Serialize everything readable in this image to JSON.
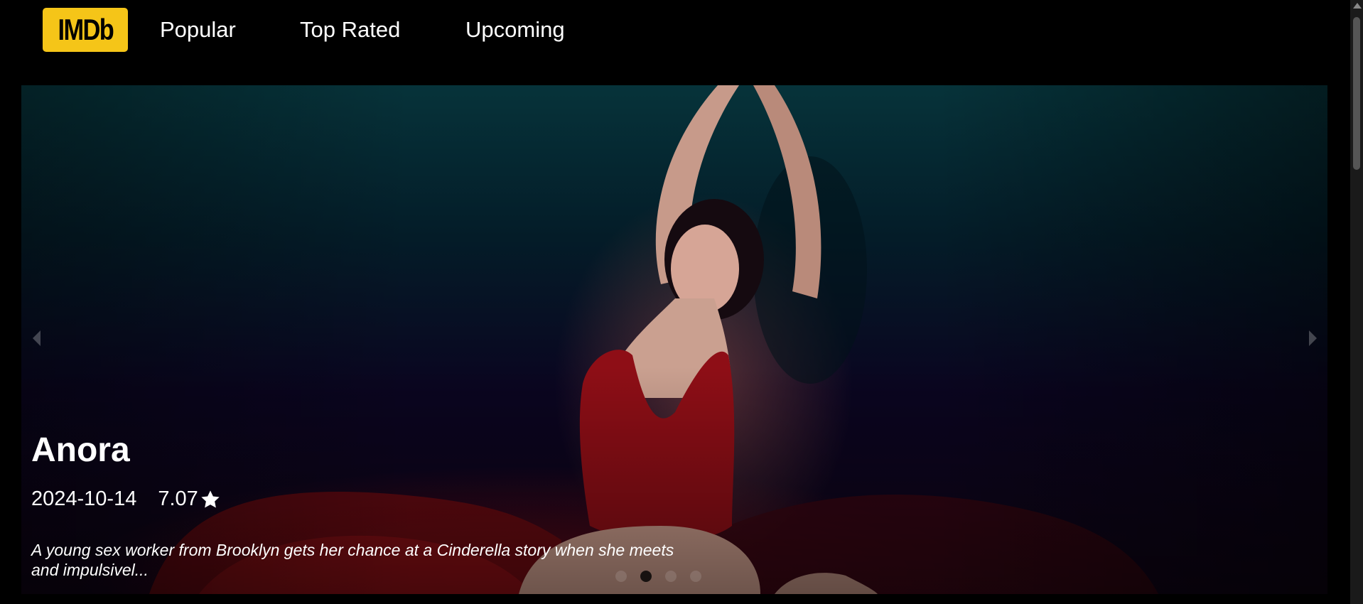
{
  "header": {
    "logo_text": "IMDb",
    "nav": {
      "popular": "Popular",
      "top_rated": "Top Rated",
      "upcoming": "Upcoming"
    }
  },
  "hero": {
    "title": "Anora",
    "release_date": "2024-10-14",
    "rating": "7.07",
    "overview": "A young sex worker from Brooklyn gets her chance at a Cinderella story when she meets and impulsivel...",
    "active_slide": 2,
    "slide_count": 4
  },
  "colors": {
    "logo_bg": "#f5c518",
    "page_bg": "#000000",
    "text": "#ffffff"
  },
  "icons": [
    "star-icon",
    "chevron-left-icon",
    "chevron-right-icon"
  ]
}
